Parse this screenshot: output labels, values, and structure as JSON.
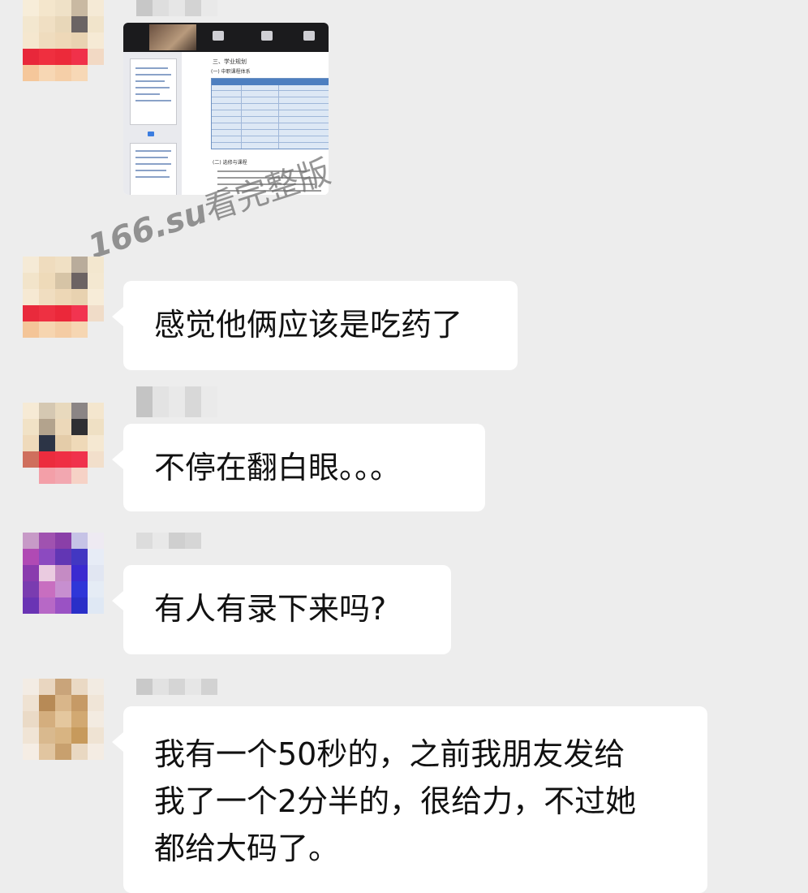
{
  "messages": [
    {
      "id": "m1",
      "type": "image",
      "image_content": {
        "doc_heading": "三、学业规划",
        "doc_subheading": "(一) 中职课程体系",
        "doc_section": "(二) 选修与课程"
      }
    },
    {
      "id": "m2",
      "type": "text",
      "text": "感觉他俩应该是吃药了"
    },
    {
      "id": "m3",
      "type": "text",
      "text": "不停在翻白眼。。。"
    },
    {
      "id": "m4",
      "type": "text",
      "text": "有人有录下来吗?"
    },
    {
      "id": "m5",
      "type": "text",
      "text_lines": [
        "我有一个50秒的，之前我朋友发给",
        "我了一个2分半的，很给力，不过她",
        "都给大码了。"
      ]
    }
  ],
  "watermark": {
    "domain": "166.su",
    "text": "看完整版"
  },
  "colors": {
    "background": "#ededed",
    "bubble": "#ffffff",
    "text": "#111111"
  }
}
